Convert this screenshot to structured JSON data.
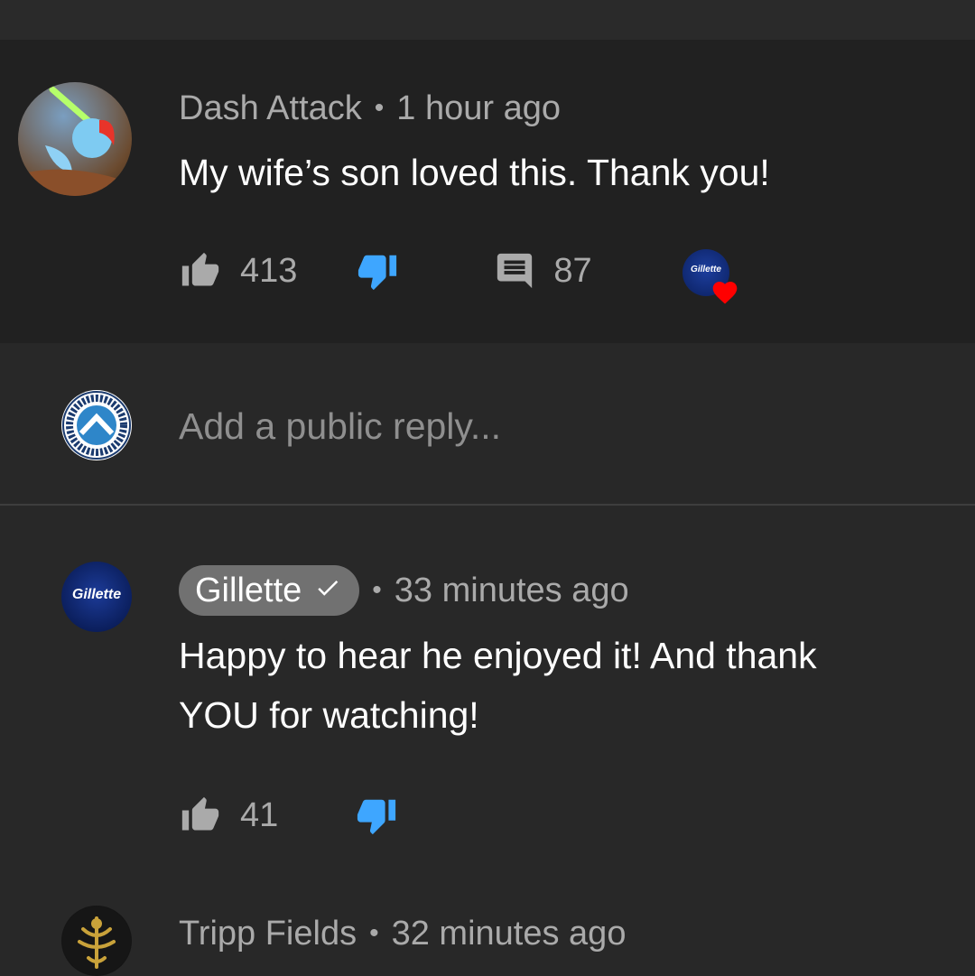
{
  "comments": [
    {
      "author": "Dash Attack",
      "time": "1 hour ago",
      "text": "My wife’s son loved this. Thank you!",
      "likes": "413",
      "replies": "87",
      "hearted_by": "Gillette"
    },
    {
      "author": "Gillette",
      "verified": true,
      "time": "33 minutes ago",
      "text_line1": "Happy to hear he enjoyed it! And thank",
      "text_line2": "YOU for watching!",
      "likes": "41"
    },
    {
      "author": "Tripp Fields",
      "time": "32 minutes ago"
    }
  ],
  "reply_box": {
    "placeholder": "Add a public reply..."
  },
  "gillette_logo_text": "Gillette",
  "colors": {
    "background": "#282828",
    "highlight": "#212121",
    "accent_blue": "#3ea6ff",
    "heart": "#ff0000",
    "meta": "#aaaaaa"
  },
  "icons": [
    "thumbs-up-icon",
    "thumbs-down-icon",
    "comment-icon",
    "heart-icon",
    "check-icon"
  ]
}
